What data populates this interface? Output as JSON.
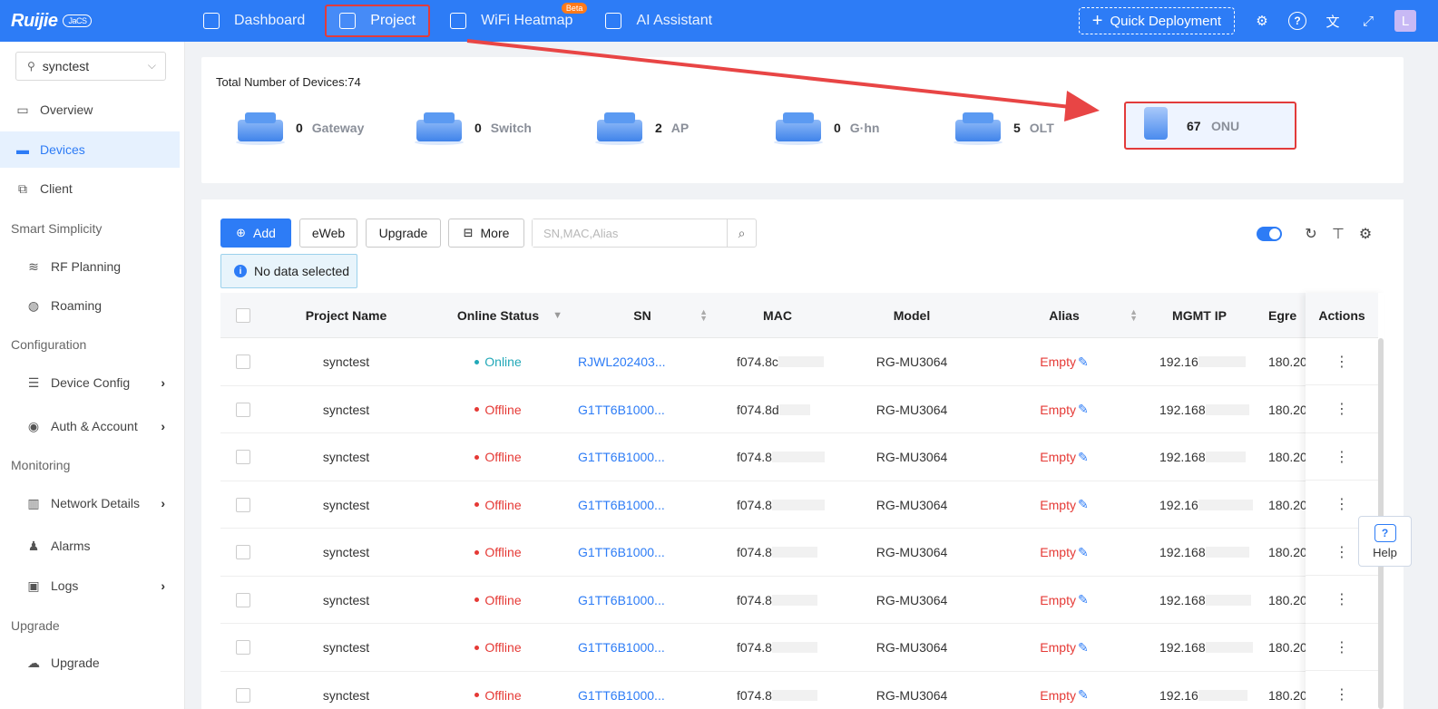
{
  "brand": {
    "name": "Ruijie",
    "cloud": "JaCS"
  },
  "topnav": [
    {
      "label": "Dashboard",
      "active": false
    },
    {
      "label": "Project",
      "active": true
    },
    {
      "label": "WiFi Heatmap",
      "active": false,
      "badge": "Beta"
    },
    {
      "label": "AI Assistant",
      "active": false
    }
  ],
  "topbar": {
    "quick_deploy": "Quick Deployment",
    "avatar": "L"
  },
  "sidebar": {
    "project": "synctest",
    "items": {
      "overview": "Overview",
      "devices": "Devices",
      "client": "Client",
      "group_smart": "Smart Simplicity",
      "rf": "RF Planning",
      "roaming": "Roaming",
      "group_config": "Configuration",
      "devconfig": "Device Config",
      "auth": "Auth & Account",
      "group_mon": "Monitoring",
      "netdetails": "Network Details",
      "alarms": "Alarms",
      "logs": "Logs",
      "group_upgrade": "Upgrade",
      "upgrade": "Upgrade"
    }
  },
  "summary": {
    "total": "Total Number of Devices:74",
    "devices": [
      {
        "count": "0",
        "name": "Gateway"
      },
      {
        "count": "0",
        "name": "Switch"
      },
      {
        "count": "2",
        "name": "AP"
      },
      {
        "count": "0",
        "name": "G·hn"
      },
      {
        "count": "5",
        "name": "OLT"
      },
      {
        "count": "67",
        "name": "ONU"
      }
    ]
  },
  "toolbar": {
    "add": "Add",
    "eweb": "eWeb",
    "upgrade": "Upgrade",
    "more": "More",
    "search_placeholder": "SN,MAC,Alias",
    "nodata": "No data selected"
  },
  "table": {
    "headers": {
      "project": "Project Name",
      "status": "Online Status",
      "sn": "SN",
      "mac": "MAC",
      "model": "Model",
      "alias": "Alias",
      "ip": "MGMT IP",
      "egress": "Egre",
      "actions": "Actions"
    },
    "rows": [
      {
        "project": "synctest",
        "status": "Online",
        "sn": "RJWL202403...",
        "mac": "f074.8c",
        "model": "RG-MU3064",
        "alias": "Empty",
        "ip": "192.16",
        "egress": "180.20"
      },
      {
        "project": "synctest",
        "status": "Offline",
        "sn": "G1TT6B1000...",
        "mac": "f074.8d",
        "model": "RG-MU3064",
        "alias": "Empty",
        "ip": "192.168",
        "egress": "180.20"
      },
      {
        "project": "synctest",
        "status": "Offline",
        "sn": "G1TT6B1000...",
        "mac": "f074.8",
        "model": "RG-MU3064",
        "alias": "Empty",
        "ip": "192.168",
        "egress": "180.20"
      },
      {
        "project": "synctest",
        "status": "Offline",
        "sn": "G1TT6B1000...",
        "mac": "f074.8",
        "model": "RG-MU3064",
        "alias": "Empty",
        "ip": "192.16",
        "egress": "180.20"
      },
      {
        "project": "synctest",
        "status": "Offline",
        "sn": "G1TT6B1000...",
        "mac": "f074.8",
        "model": "RG-MU3064",
        "alias": "Empty",
        "ip": "192.168",
        "egress": "180.20"
      },
      {
        "project": "synctest",
        "status": "Offline",
        "sn": "G1TT6B1000...",
        "mac": "f074.8",
        "model": "RG-MU3064",
        "alias": "Empty",
        "ip": "192.168",
        "egress": "180.20"
      },
      {
        "project": "synctest",
        "status": "Offline",
        "sn": "G1TT6B1000...",
        "mac": "f074.8",
        "model": "RG-MU3064",
        "alias": "Empty",
        "ip": "192.168",
        "egress": "180.20"
      },
      {
        "project": "synctest",
        "status": "Offline",
        "sn": "G1TT6B1000...",
        "mac": "f074.8",
        "model": "RG-MU3064",
        "alias": "Empty",
        "ip": "192.16",
        "egress": "180.20"
      }
    ]
  },
  "help": "Help",
  "colors": {
    "primary": "#2d7cf6",
    "highlight": "#e23b3b",
    "online": "#22a8b8",
    "offline": "#e53935"
  }
}
